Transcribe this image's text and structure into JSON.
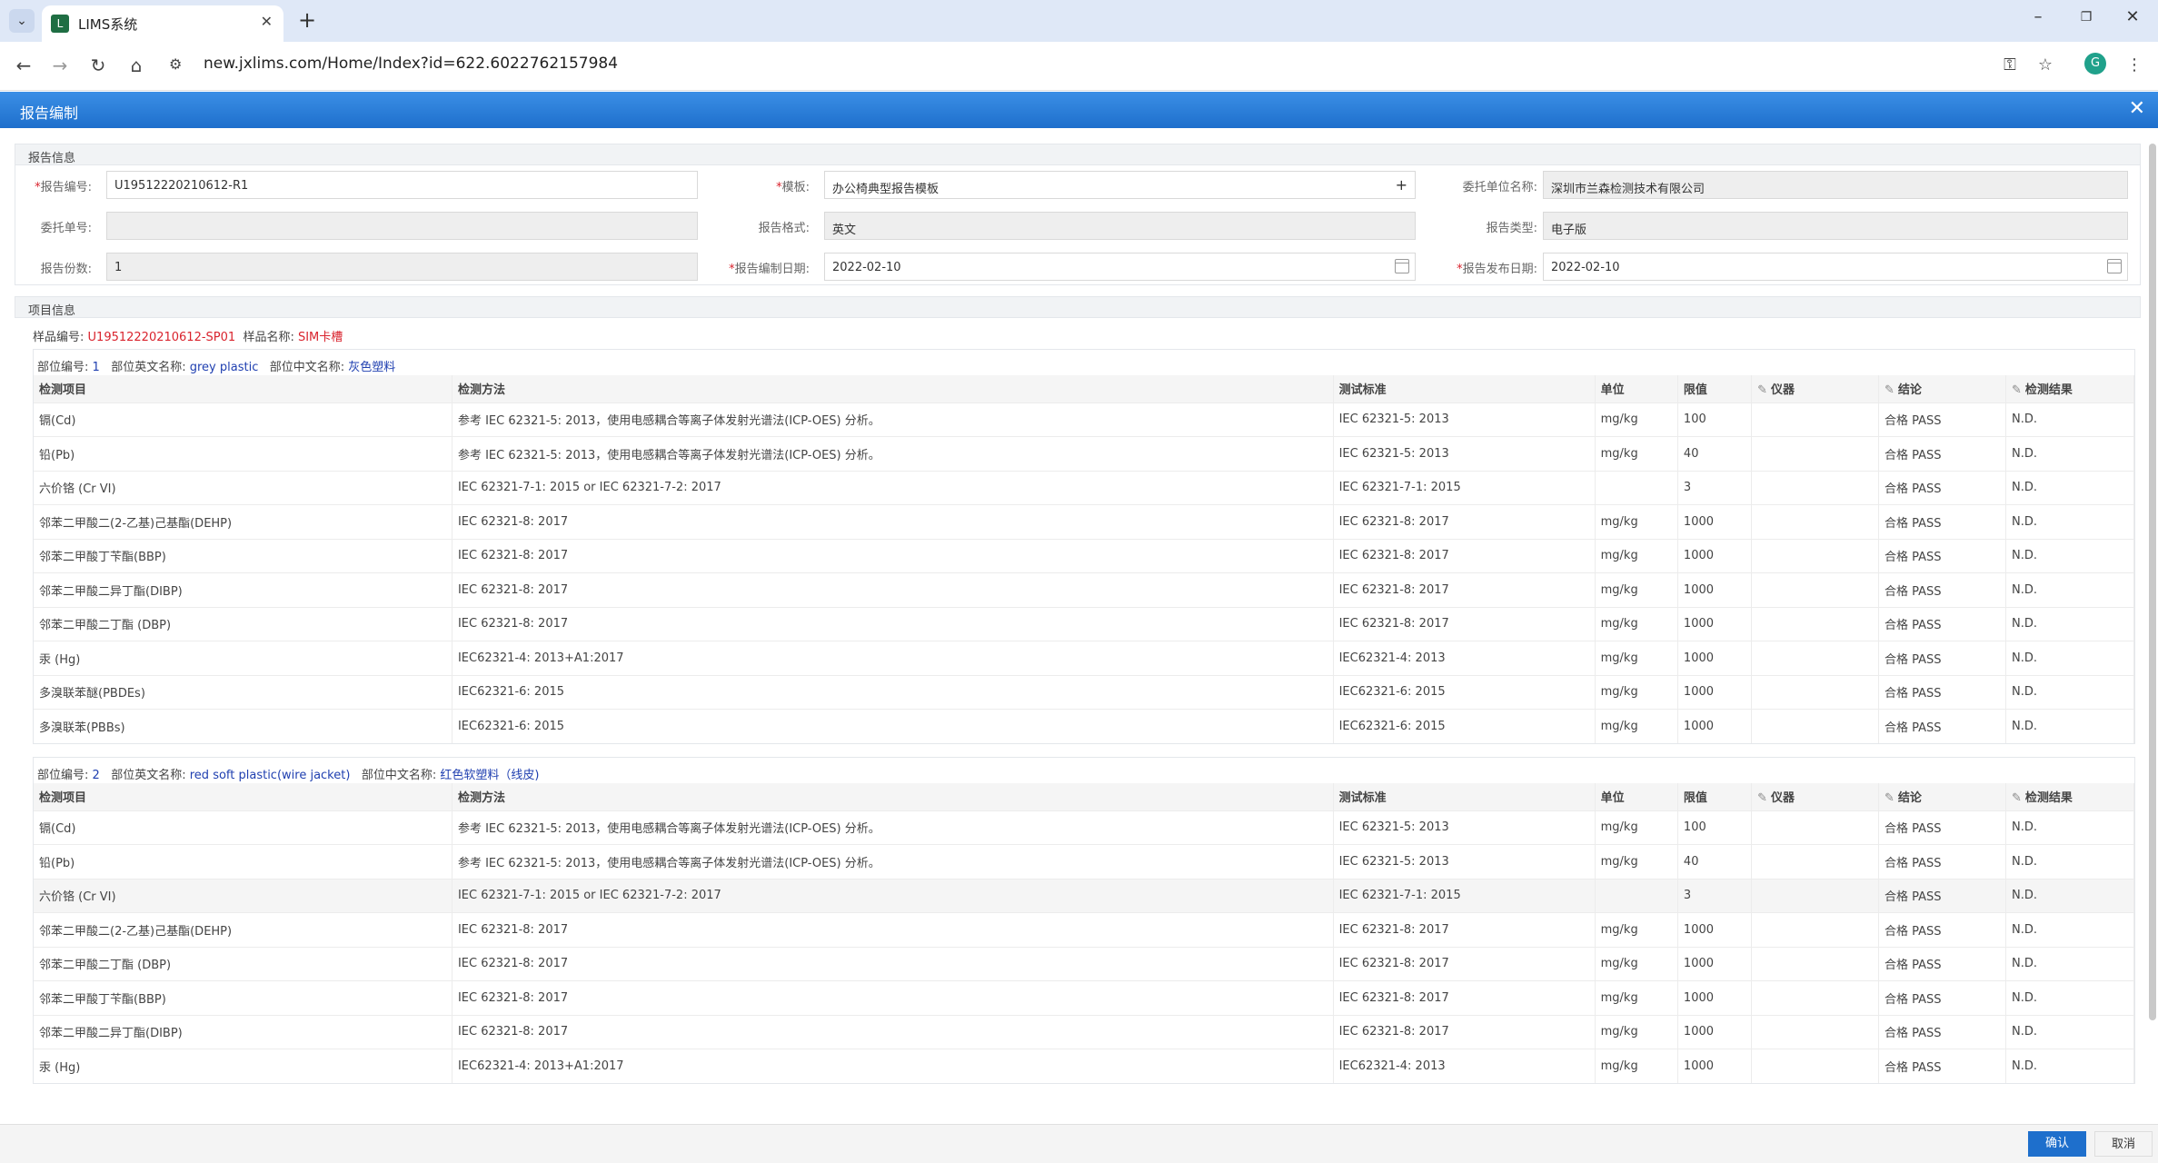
{
  "browser": {
    "tab_title": "LIMS系统",
    "url": "new.jxlims.com/Home/Index?id=622.6022762157984",
    "avatar_letter": "G"
  },
  "dialog": {
    "title": "报告编制",
    "ok_label": "确认",
    "cancel_label": "取消"
  },
  "report_info": {
    "section_title": "报告信息",
    "report_no_label": "报告编号:",
    "report_no": "U19512220210612-R1",
    "template_label": "模板:",
    "template": "办公椅典型报告模板",
    "client_label": "委托单位名称:",
    "client": "深圳市兰森检测技术有限公司",
    "order_no_label": "委托单号:",
    "order_no": "",
    "format_label": "报告格式:",
    "format": "英文",
    "type_label": "报告类型:",
    "type": "电子版",
    "copies_label": "报告份数:",
    "copies": "1",
    "compile_date_label": "报告编制日期:",
    "compile_date": "2022-02-10",
    "publish_date_label": "报告发布日期:",
    "publish_date": "2022-02-10"
  },
  "project_info": {
    "section_title": "项目信息",
    "sample_no_label": "样品编号:",
    "sample_no": "U19512220210612-SP01",
    "sample_name_label": "样品名称:",
    "sample_name": "SIM卡槽"
  },
  "table_headers": [
    "检测项目",
    "检测方法",
    "测试标准",
    "单位",
    "限值",
    "仪器",
    "结论",
    "检测结果"
  ],
  "parts": [
    {
      "part_no_label": "部位编号:",
      "part_no": "1",
      "en_label": "部位英文名称:",
      "en_name": "grey plastic",
      "cn_label": "部位中文名称:",
      "cn_name": "灰色塑料",
      "rows": [
        [
          "镉(Cd)",
          "参考 IEC 62321-5: 2013，使用电感耦合等离子体发射光谱法(ICP-OES) 分析。",
          "IEC 62321-5: 2013",
          "mg/kg",
          "100",
          "",
          "合格 PASS",
          "N.D."
        ],
        [
          "铅(Pb)",
          "参考 IEC 62321-5: 2013，使用电感耦合等离子体发射光谱法(ICP-OES) 分析。",
          "IEC 62321-5: 2013",
          "mg/kg",
          "40",
          "",
          "合格 PASS",
          "N.D."
        ],
        [
          "六价铬 (Cr VI)",
          "IEC 62321-7-1: 2015 or IEC 62321-7-2: 2017",
          "IEC 62321-7-1: 2015",
          "",
          "3",
          "",
          "合格 PASS",
          "N.D."
        ],
        [
          "邻苯二甲酸二(2-乙基)己基酯(DEHP)",
          "IEC 62321-8: 2017",
          "IEC 62321-8: 2017",
          "mg/kg",
          "1000",
          "",
          "合格 PASS",
          "N.D."
        ],
        [
          "邻苯二甲酸丁苄酯(BBP)",
          "IEC 62321-8: 2017",
          "IEC 62321-8: 2017",
          "mg/kg",
          "1000",
          "",
          "合格 PASS",
          "N.D."
        ],
        [
          "邻苯二甲酸二异丁酯(DIBP)",
          "IEC 62321-8: 2017",
          "IEC 62321-8: 2017",
          "mg/kg",
          "1000",
          "",
          "合格 PASS",
          "N.D."
        ],
        [
          "邻苯二甲酸二丁酯 (DBP)",
          "IEC 62321-8: 2017",
          "IEC 62321-8: 2017",
          "mg/kg",
          "1000",
          "",
          "合格 PASS",
          "N.D."
        ],
        [
          "汞 (Hg)",
          "IEC62321-4: 2013+A1:2017",
          "IEC62321-4: 2013",
          "mg/kg",
          "1000",
          "",
          "合格 PASS",
          "N.D."
        ],
        [
          "多溴联苯醚(PBDEs)",
          "IEC62321-6: 2015",
          "IEC62321-6: 2015",
          "mg/kg",
          "1000",
          "",
          "合格 PASS",
          "N.D."
        ],
        [
          "多溴联苯(PBBs)",
          "IEC62321-6: 2015",
          "IEC62321-6: 2015",
          "mg/kg",
          "1000",
          "",
          "合格 PASS",
          "N.D."
        ]
      ]
    },
    {
      "part_no_label": "部位编号:",
      "part_no": "2",
      "en_label": "部位英文名称:",
      "en_name": "red soft plastic(wire jacket)",
      "cn_label": "部位中文名称:",
      "cn_name": "红色软塑料（线皮)",
      "rows": [
        [
          "镉(Cd)",
          "参考 IEC 62321-5: 2013，使用电感耦合等离子体发射光谱法(ICP-OES) 分析。",
          "IEC 62321-5: 2013",
          "mg/kg",
          "100",
          "",
          "合格 PASS",
          "N.D."
        ],
        [
          "铅(Pb)",
          "参考 IEC 62321-5: 2013，使用电感耦合等离子体发射光谱法(ICP-OES) 分析。",
          "IEC 62321-5: 2013",
          "mg/kg",
          "40",
          "",
          "合格 PASS",
          "N.D."
        ],
        [
          "六价铬 (Cr VI)",
          "IEC 62321-7-1: 2015 or IEC 62321-7-2: 2017",
          "IEC 62321-7-1: 2015",
          "",
          "3",
          "",
          "合格 PASS",
          "N.D."
        ],
        [
          "邻苯二甲酸二(2-乙基)己基酯(DEHP)",
          "IEC 62321-8: 2017",
          "IEC 62321-8: 2017",
          "mg/kg",
          "1000",
          "",
          "合格 PASS",
          "N.D."
        ],
        [
          "邻苯二甲酸二丁酯 (DBP)",
          "IEC 62321-8: 2017",
          "IEC 62321-8: 2017",
          "mg/kg",
          "1000",
          "",
          "合格 PASS",
          "N.D."
        ],
        [
          "邻苯二甲酸丁苄酯(BBP)",
          "IEC 62321-8: 2017",
          "IEC 62321-8: 2017",
          "mg/kg",
          "1000",
          "",
          "合格 PASS",
          "N.D."
        ],
        [
          "邻苯二甲酸二异丁酯(DIBP)",
          "IEC 62321-8: 2017",
          "IEC 62321-8: 2017",
          "mg/kg",
          "1000",
          "",
          "合格 PASS",
          "N.D."
        ],
        [
          "汞 (Hg)",
          "IEC62321-4: 2013+A1:2017",
          "IEC62321-4: 2013",
          "mg/kg",
          "1000",
          "",
          "合格 PASS",
          "N.D."
        ]
      ]
    }
  ]
}
